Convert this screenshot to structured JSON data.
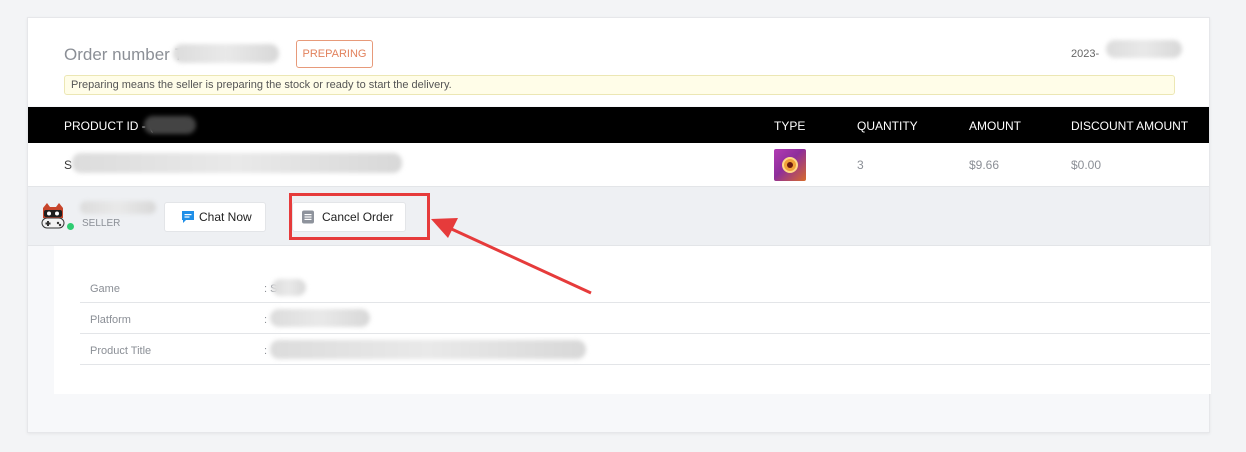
{
  "order": {
    "number_label": "Order number 7",
    "status": "PREPARING",
    "date": "2023-",
    "hint": "Preparing means the seller is preparing the stock or ready to start the delivery."
  },
  "table": {
    "headers": {
      "product_id": "PRODUCT ID - (",
      "type": "TYPE",
      "quantity": "QUANTITY",
      "amount": "AMOUNT",
      "discount": "DISCOUNT AMOUNT"
    },
    "row": {
      "product_name": "S",
      "quantity": "3",
      "amount": "$9.66",
      "discount": "$0.00"
    }
  },
  "seller": {
    "role_label": "SELLER",
    "chat_label": "Chat Now",
    "cancel_label": "Cancel Order"
  },
  "details": [
    {
      "label": "Game",
      "value": ": S"
    },
    {
      "label": "Platform",
      "value": ":"
    },
    {
      "label": "Product Title",
      "value": ":"
    }
  ],
  "colors": {
    "status": "#e2825d",
    "header_bg": "#000000",
    "highlight": "#e63b3b",
    "online": "#2ecc71"
  },
  "icons": [
    "chat-icon",
    "order-list-icon",
    "seller-avatar-icon",
    "annotation-arrow-icon"
  ]
}
